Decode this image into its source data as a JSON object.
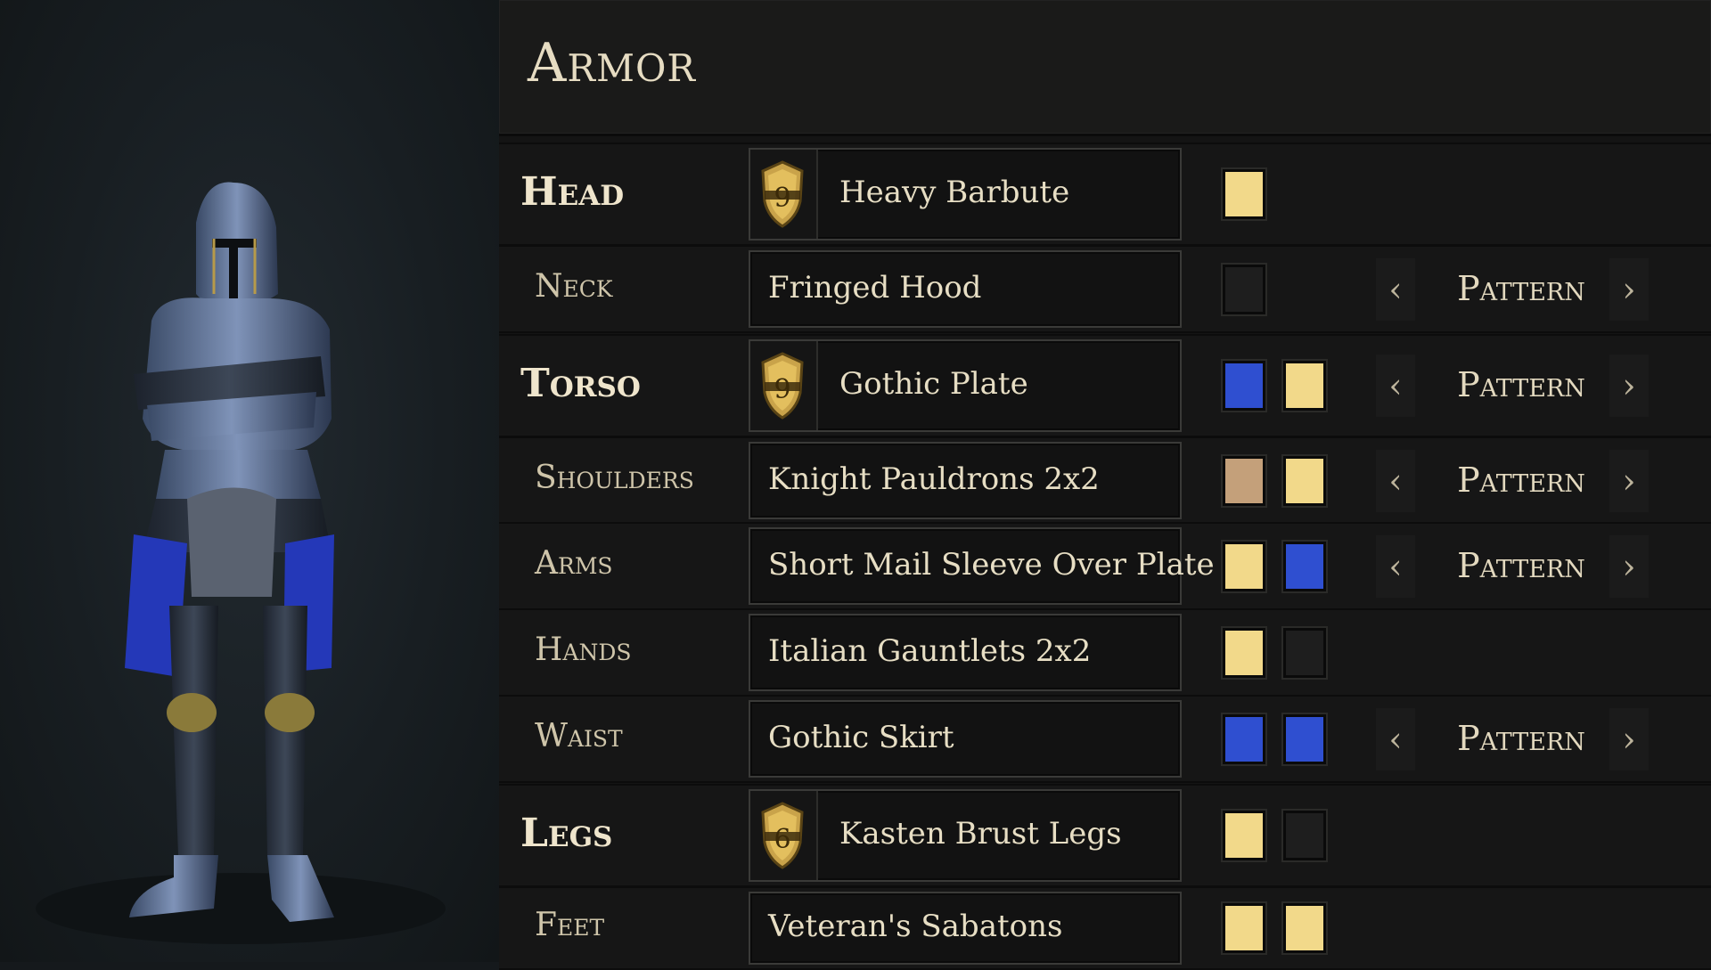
{
  "panel": {
    "title": "Armor"
  },
  "colors": {
    "gold": "#f2d98a",
    "blue": "#2f4fd0",
    "tan": "#c4a07a",
    "dark": "#1e1e1e"
  },
  "pattern_label": "Pattern",
  "slots": [
    {
      "key": "head",
      "label": "Head",
      "major": true,
      "tier": "9",
      "item": "Heavy Barbute",
      "swatches": [
        "gold"
      ],
      "pattern": false
    },
    {
      "key": "neck",
      "label": "Neck",
      "major": false,
      "tier": null,
      "item": "Fringed Hood",
      "swatches": [
        "dark"
      ],
      "pattern": true
    },
    {
      "key": "torso",
      "label": "Torso",
      "major": true,
      "tier": "9",
      "item": "Gothic Plate",
      "swatches": [
        "blue",
        "gold"
      ],
      "pattern": true
    },
    {
      "key": "shoulders",
      "label": "Shoulders",
      "major": false,
      "tier": null,
      "item": "Knight Pauldrons 2x2",
      "swatches": [
        "tan",
        "gold"
      ],
      "pattern": true
    },
    {
      "key": "arms",
      "label": "Arms",
      "major": false,
      "tier": null,
      "item": "Short Mail Sleeve Over Plate",
      "swatches": [
        "gold",
        "blue"
      ],
      "pattern": true
    },
    {
      "key": "hands",
      "label": "Hands",
      "major": false,
      "tier": null,
      "item": "Italian Gauntlets 2x2",
      "swatches": [
        "gold",
        "dark"
      ],
      "pattern": false
    },
    {
      "key": "waist",
      "label": "Waist",
      "major": false,
      "tier": null,
      "item": "Gothic Skirt",
      "swatches": [
        "blue",
        "blue"
      ],
      "pattern": true
    },
    {
      "key": "legs",
      "label": "Legs",
      "major": true,
      "tier": "6",
      "item": "Kasten Brust Legs",
      "swatches": [
        "gold",
        "dark"
      ],
      "pattern": false
    },
    {
      "key": "feet",
      "label": "Feet",
      "major": false,
      "tier": null,
      "item": "Veteran's Sabatons",
      "swatches": [
        "gold",
        "gold"
      ],
      "pattern": false
    }
  ]
}
